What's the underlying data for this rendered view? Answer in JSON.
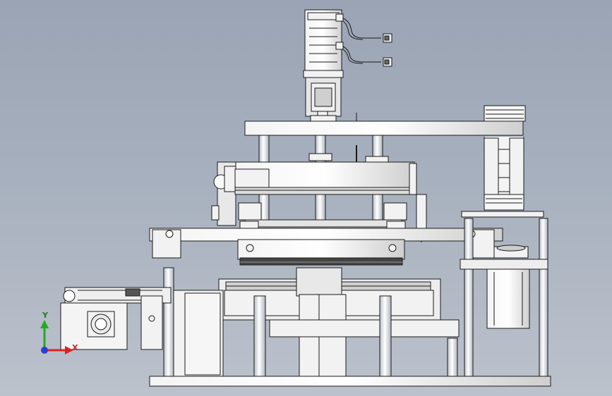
{
  "axes": {
    "y_label": "Y",
    "x_label": "X",
    "colors": {
      "y": "#22aa22",
      "x": "#dd2222",
      "z": "#2a3fd6"
    }
  },
  "parts": [
    "servo-motor",
    "motor-coupling",
    "top-plate",
    "guide-posts",
    "linear-module",
    "cable-chain",
    "gripper-frame",
    "pressing-head",
    "conveyor",
    "base-plate",
    "stepper-motor",
    "support-columns"
  ]
}
